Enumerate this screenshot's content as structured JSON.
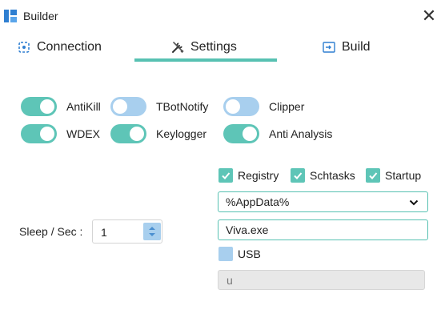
{
  "window": {
    "title": "Builder",
    "close_glyph": "✕"
  },
  "tabs": [
    {
      "label": "Connection",
      "icon": "connection-icon"
    },
    {
      "label": "Settings",
      "icon": "tools-icon",
      "active": true
    },
    {
      "label": "Build",
      "icon": "build-icon"
    }
  ],
  "toggles": [
    {
      "label": "AntiKill",
      "on": true
    },
    {
      "label": "TBotNotify",
      "on": false
    },
    {
      "label": "Clipper",
      "on": false
    },
    {
      "label": "WDEX",
      "on": true
    },
    {
      "label": "Keylogger",
      "on": true
    },
    {
      "label": "Anti Analysis",
      "on": true
    }
  ],
  "checkboxes": [
    {
      "label": "Registry",
      "checked": true
    },
    {
      "label": "Schtasks",
      "checked": true
    },
    {
      "label": "Startup",
      "checked": true
    }
  ],
  "install_path": {
    "value": "%AppData%"
  },
  "file_name": {
    "value": "Viva.exe"
  },
  "usb": {
    "label": "USB",
    "checked": false
  },
  "usb_name": {
    "value": "u"
  },
  "sleep": {
    "label": "Sleep / Sec :",
    "value": "1"
  },
  "colors": {
    "accent": "#5ec5b7",
    "off": "#a8cfee"
  }
}
